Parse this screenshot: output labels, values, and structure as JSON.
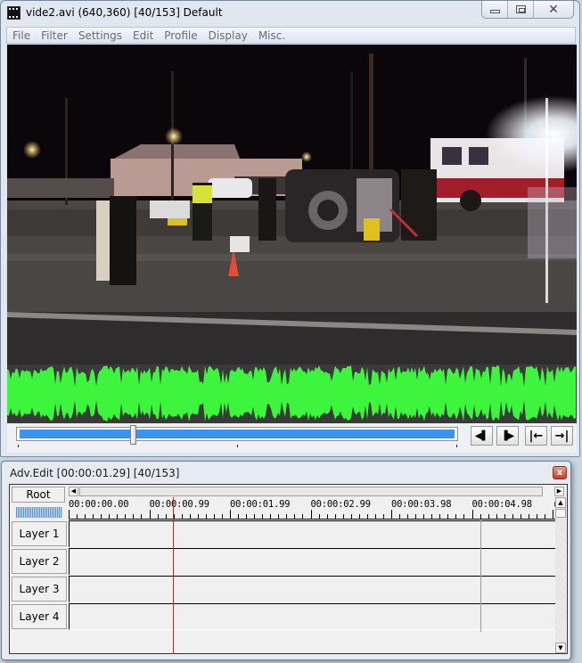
{
  "main_window": {
    "title": "vide2.avi (640,360)  [40/153]  Default",
    "icon": "film-icon",
    "controls": {
      "minimize": "minimize-icon",
      "maximize": "maximize-icon",
      "close": "✕"
    }
  },
  "menu": {
    "items": [
      {
        "label": "File"
      },
      {
        "label": "Filter"
      },
      {
        "label": "Settings"
      },
      {
        "label": "Edit"
      },
      {
        "label": "Profile"
      },
      {
        "label": "Display"
      },
      {
        "label": "Misc."
      }
    ]
  },
  "video": {
    "description": "Night scene: overturned vehicle on road with firefighters and a fire truck",
    "current_frame": 40,
    "total_frames": 153
  },
  "playback": {
    "position_fraction": 0.26,
    "waveform_color": "#3cf53c",
    "seek_color": "#3b93f0",
    "buttons": [
      {
        "name": "prev-frame",
        "glyph": "◀▌"
      },
      {
        "name": "next-frame",
        "glyph": "▐▶"
      },
      {
        "name": "jump-start",
        "glyph": "|←"
      },
      {
        "name": "jump-end",
        "glyph": "→|"
      }
    ]
  },
  "adv_edit": {
    "title": "Adv.Edit [00:00:01.29] [40/153]",
    "close_glyph": "x",
    "root_label": "Root",
    "ruler_labels": [
      "00:00:00.00",
      "00:00:00.99",
      "00:00:01.99",
      "00:00:02.99",
      "00:00:03.98",
      "00:00:04.98",
      "("
    ],
    "cursor_time_seconds": 1.29,
    "end_time_seconds": 5.1,
    "cursor_color": "#cc2020",
    "layers": [
      {
        "label": "Layer  1"
      },
      {
        "label": "Layer  2"
      },
      {
        "label": "Layer  3"
      },
      {
        "label": "Layer  4"
      }
    ]
  }
}
